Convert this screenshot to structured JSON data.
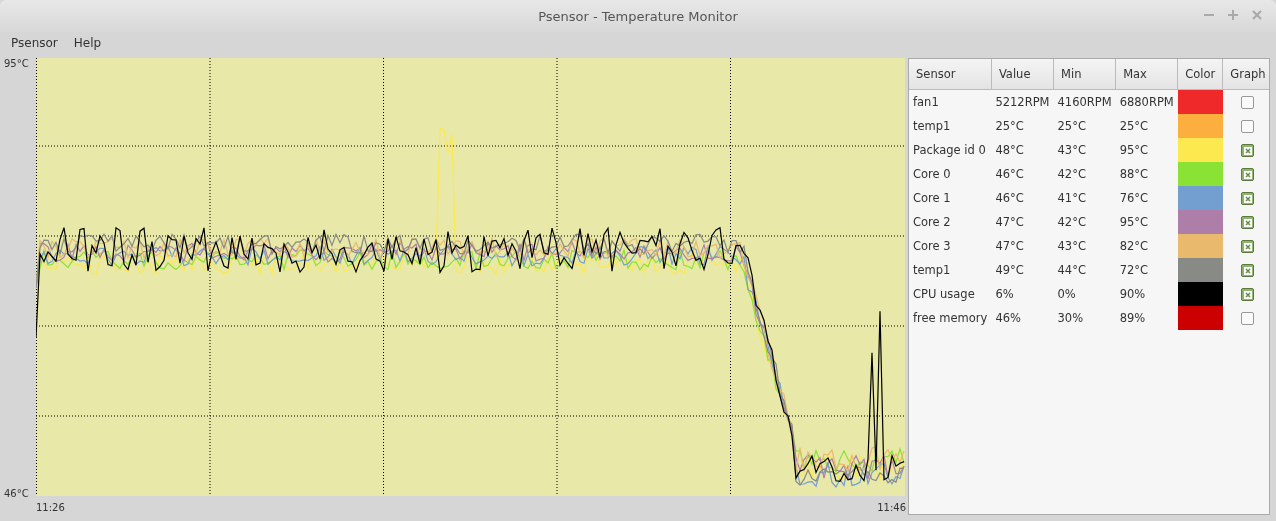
{
  "window": {
    "title": "Psensor - Temperature Monitor"
  },
  "menu": [
    "Psensor",
    "Help"
  ],
  "graph": {
    "y_max_label": "95°C",
    "y_min_label": "46°C",
    "x_start_label": "11:26",
    "x_end_label": "11:46"
  },
  "table": {
    "columns": [
      "Sensor",
      "Value",
      "Min",
      "Max",
      "Color",
      "Graph"
    ],
    "rows": [
      {
        "sensor": "fan1",
        "value": "5212RPM",
        "min": "4160RPM",
        "max": "6880RPM",
        "color": "#ef2929",
        "graph": false
      },
      {
        "sensor": "temp1",
        "value": "25°C",
        "min": "25°C",
        "max": "25°C",
        "color": "#fcaf3e",
        "graph": false
      },
      {
        "sensor": "Package id 0",
        "value": "48°C",
        "min": "43°C",
        "max": "95°C",
        "color": "#fce94f",
        "graph": true
      },
      {
        "sensor": "Core 0",
        "value": "46°C",
        "min": "42°C",
        "max": "88°C",
        "color": "#8ae234",
        "graph": true
      },
      {
        "sensor": "Core 1",
        "value": "46°C",
        "min": "41°C",
        "max": "76°C",
        "color": "#729fcf",
        "graph": true
      },
      {
        "sensor": "Core 2",
        "value": "47°C",
        "min": "42°C",
        "max": "95°C",
        "color": "#ad7fa8",
        "graph": true
      },
      {
        "sensor": "Core 3",
        "value": "47°C",
        "min": "43°C",
        "max": "82°C",
        "color": "#e9b96e",
        "graph": true
      },
      {
        "sensor": "temp1",
        "value": "49°C",
        "min": "44°C",
        "max": "72°C",
        "color": "#888a85",
        "graph": true
      },
      {
        "sensor": "CPU usage",
        "value": "6%",
        "min": "0%",
        "max": "90%",
        "color": "#000000",
        "graph": true
      },
      {
        "sensor": "free memory",
        "value": "46%",
        "min": "30%",
        "max": "89%",
        "color": "#cc0000",
        "graph": false
      }
    ]
  }
}
